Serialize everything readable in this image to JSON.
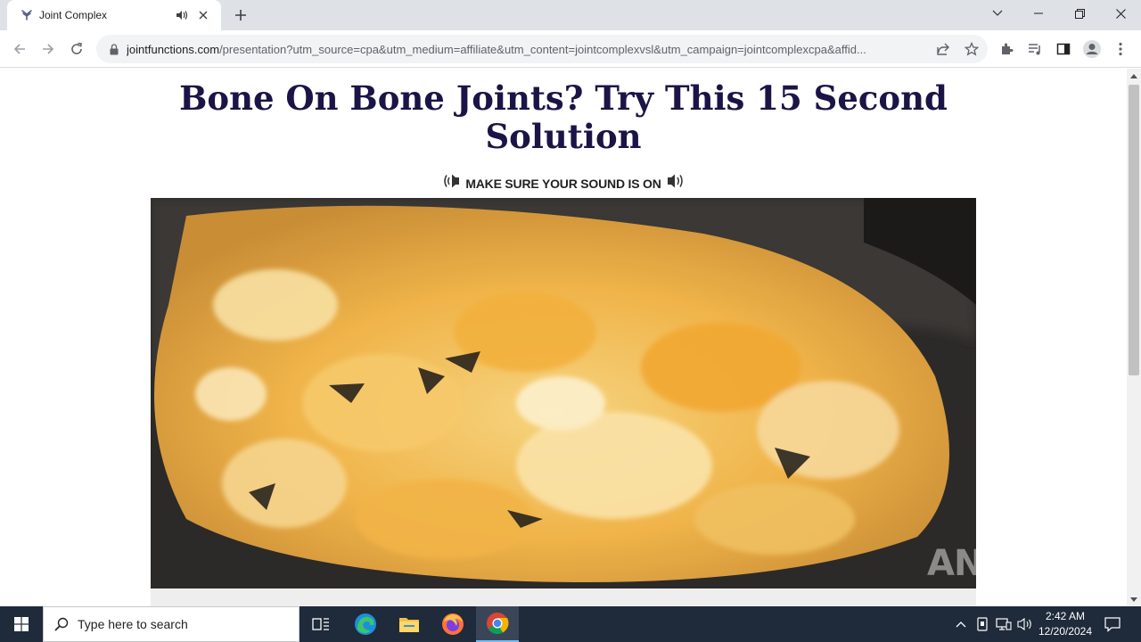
{
  "browser": {
    "tab": {
      "title": "Joint Complex"
    },
    "url": {
      "host": "jointfunctions.com",
      "path": "/presentation?utm_source=cpa&utm_medium=affiliate&utm_content=jointcomplexvsl&utm_campaign=jointcomplexcpa&affid..."
    }
  },
  "page": {
    "headline": "Bone On Bone Joints? Try This 15 Second Solution",
    "sound_note": "MAKE SURE YOUR SOUND IS ON",
    "watermark": "ANY RUN"
  },
  "taskbar": {
    "search_placeholder": "Type here to search",
    "time": "2:42 AM",
    "date": "12/20/2024"
  },
  "colors": {
    "headline": "#1b1446",
    "taskbar": "#1f2a3a",
    "tab_strip": "#dee1e6"
  }
}
